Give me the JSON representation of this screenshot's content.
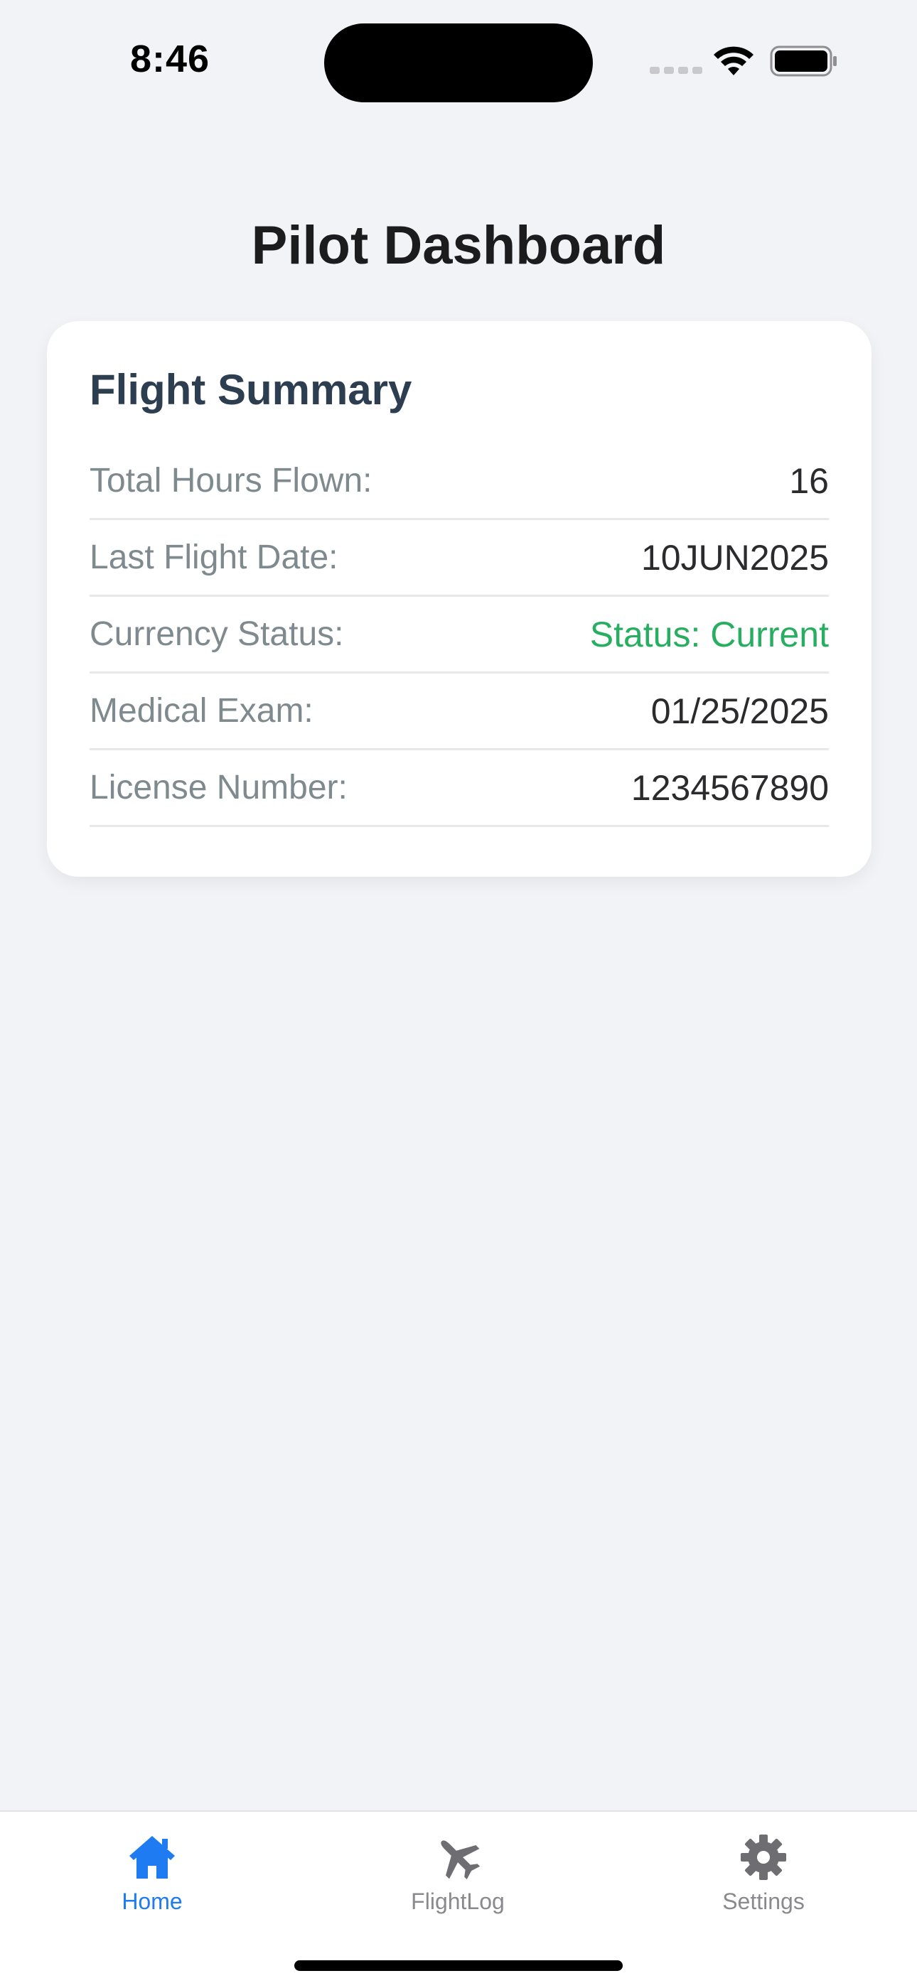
{
  "status_bar": {
    "time": "8:46"
  },
  "header": {
    "title": "Pilot Dashboard"
  },
  "flight_summary": {
    "title": "Flight Summary",
    "rows": [
      {
        "label": "Total Hours Flown:",
        "value": "16"
      },
      {
        "label": "Last Flight Date:",
        "value": "10JUN2025"
      },
      {
        "label": "Currency Status:",
        "value": "Status: Current"
      },
      {
        "label": "Medical Exam:",
        "value": "01/25/2025"
      },
      {
        "label": "License Number:",
        "value": "1234567890"
      }
    ]
  },
  "tab_bar": {
    "tabs": [
      {
        "label": "Home",
        "icon": "house-icon",
        "active": true
      },
      {
        "label": "FlightLog",
        "icon": "airplane-icon",
        "active": false
      },
      {
        "label": "Settings",
        "icon": "gear-icon",
        "active": false
      }
    ]
  },
  "colors": {
    "background": "#f2f3f7",
    "accent": "#1e7bf2",
    "status_current": "#27ae60",
    "card_title": "#2c3e50",
    "label_gray": "#7f8a8f",
    "inactive_tab": "#8a8a8e"
  }
}
